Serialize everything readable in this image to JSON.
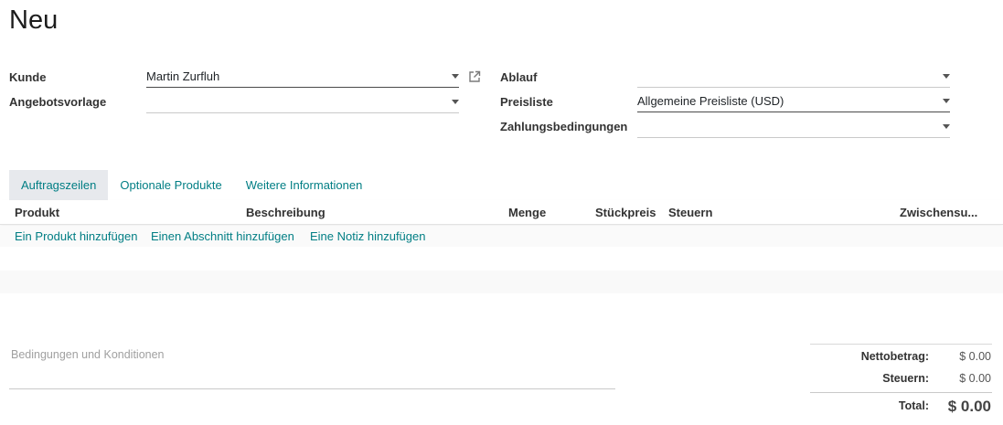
{
  "page": {
    "title": "Neu"
  },
  "form": {
    "left": {
      "kunde_label": "Kunde",
      "kunde_value": "Martin Zurfluh",
      "vorlage_label": "Angebotsvorlage",
      "vorlage_value": ""
    },
    "right": {
      "ablauf_label": "Ablauf",
      "ablauf_value": "",
      "preisliste_label": "Preisliste",
      "preisliste_value": "Allgemeine Preisliste (USD)",
      "zahlung_label": "Zahlungsbedingungen",
      "zahlung_value": ""
    }
  },
  "tabs": [
    {
      "label": "Auftragszeilen",
      "active": true
    },
    {
      "label": "Optionale Produkte",
      "active": false
    },
    {
      "label": "Weitere Informationen",
      "active": false
    }
  ],
  "table": {
    "headers": [
      "Produkt",
      "Beschreibung",
      "Menge",
      "Stückpreis",
      "Steuern",
      "Zwischensu..."
    ],
    "actions": [
      "Ein Produkt hinzufügen",
      "Einen Abschnitt hinzufügen",
      "Eine Notiz hinzufügen"
    ]
  },
  "terms": {
    "placeholder": "Bedingungen und Konditionen"
  },
  "totals": {
    "net_label": "Nettobetrag:",
    "net_value": "$ 0.00",
    "tax_label": "Steuern:",
    "tax_value": "$ 0.00",
    "total_label": "Total:",
    "total_value": "$ 0.00"
  },
  "colors": {
    "accent": "#017e84",
    "tab_active_bg": "#e7e9ed"
  },
  "icons": {
    "external_link": "external-link-icon",
    "dropdown": "caret-down-icon"
  }
}
